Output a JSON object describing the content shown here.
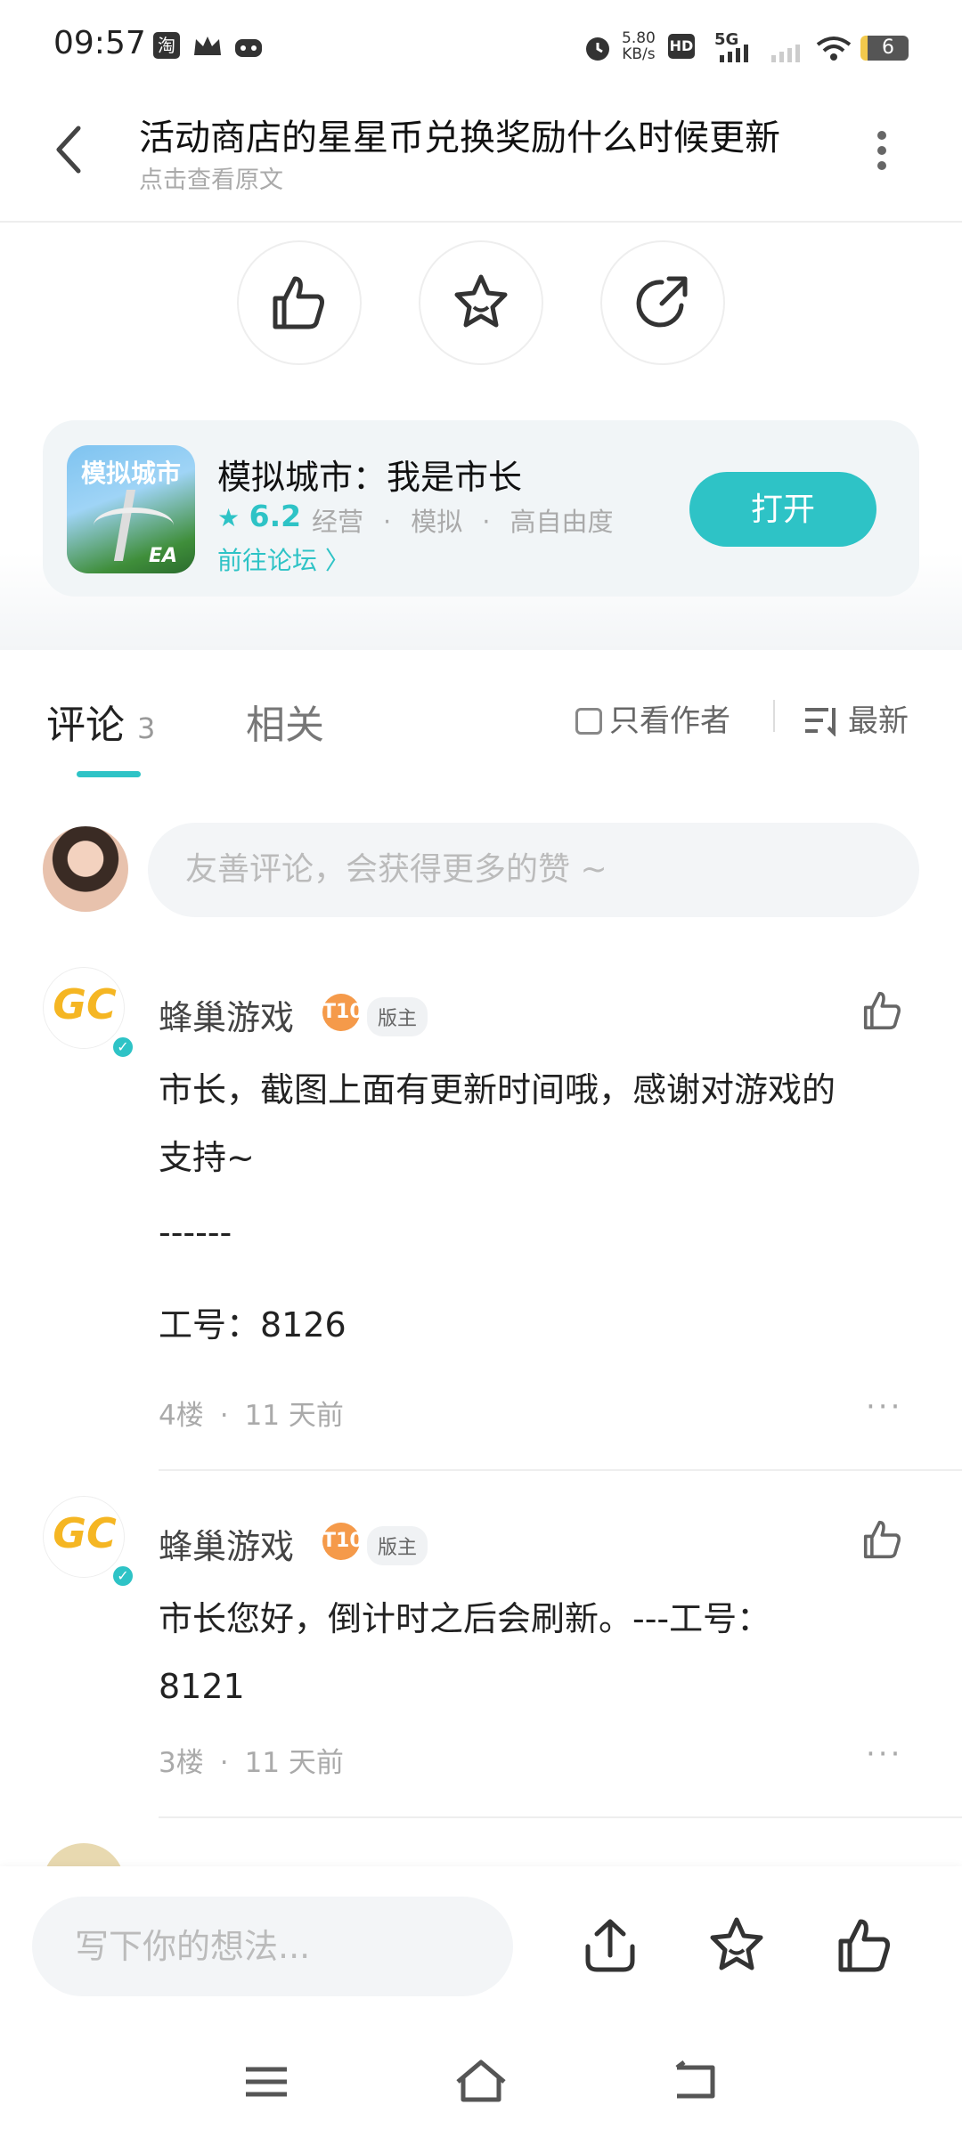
{
  "status_bar": {
    "time": "09:57",
    "icons": [
      "taobao-icon",
      "crown-icon",
      "game-controller-icon"
    ],
    "net_speed": "5.80",
    "net_unit": "KB/s",
    "hd": "HD",
    "network": "5G",
    "battery": "6"
  },
  "header": {
    "title": "活动商店的星星币兑换奖励什么时候更新",
    "subtitle": "点击查看原文"
  },
  "app_card": {
    "name": "模拟城市：我是市长",
    "rating": "6.2",
    "tags": [
      "经营",
      "模拟",
      "高自由度"
    ],
    "separator": "·",
    "forum_link": "前往论坛",
    "open_button": "打开",
    "icon_text": "模拟城市",
    "publisher": "EA"
  },
  "tabs": {
    "comments_label": "评论",
    "comments_count": "3",
    "related_label": "相关",
    "only_author": "只看作者",
    "sort": "最新"
  },
  "comment_input": {
    "placeholder": "友善评论，会获得更多的赞 ~"
  },
  "comments": [
    {
      "author": "蜂巢游戏",
      "level": "T10",
      "badge": "版主",
      "text_lines": [
        "市长，截图上面有更新时间哦，感谢对游戏的",
        "支持~",
        "------",
        "工号：8126"
      ],
      "floor": "4楼",
      "time": "11 天前"
    },
    {
      "author": "蜂巢游戏",
      "level": "T10",
      "badge": "版主",
      "text_lines": [
        "市长您好，倒计时之后会刷新。---工号：",
        "8121"
      ],
      "floor": "3楼",
      "time": "11 天前"
    }
  ],
  "bottom_bar": {
    "placeholder": "写下你的想法..."
  },
  "colors": {
    "accent": "#2ec3c6",
    "level_badge": "#f59a4a"
  }
}
